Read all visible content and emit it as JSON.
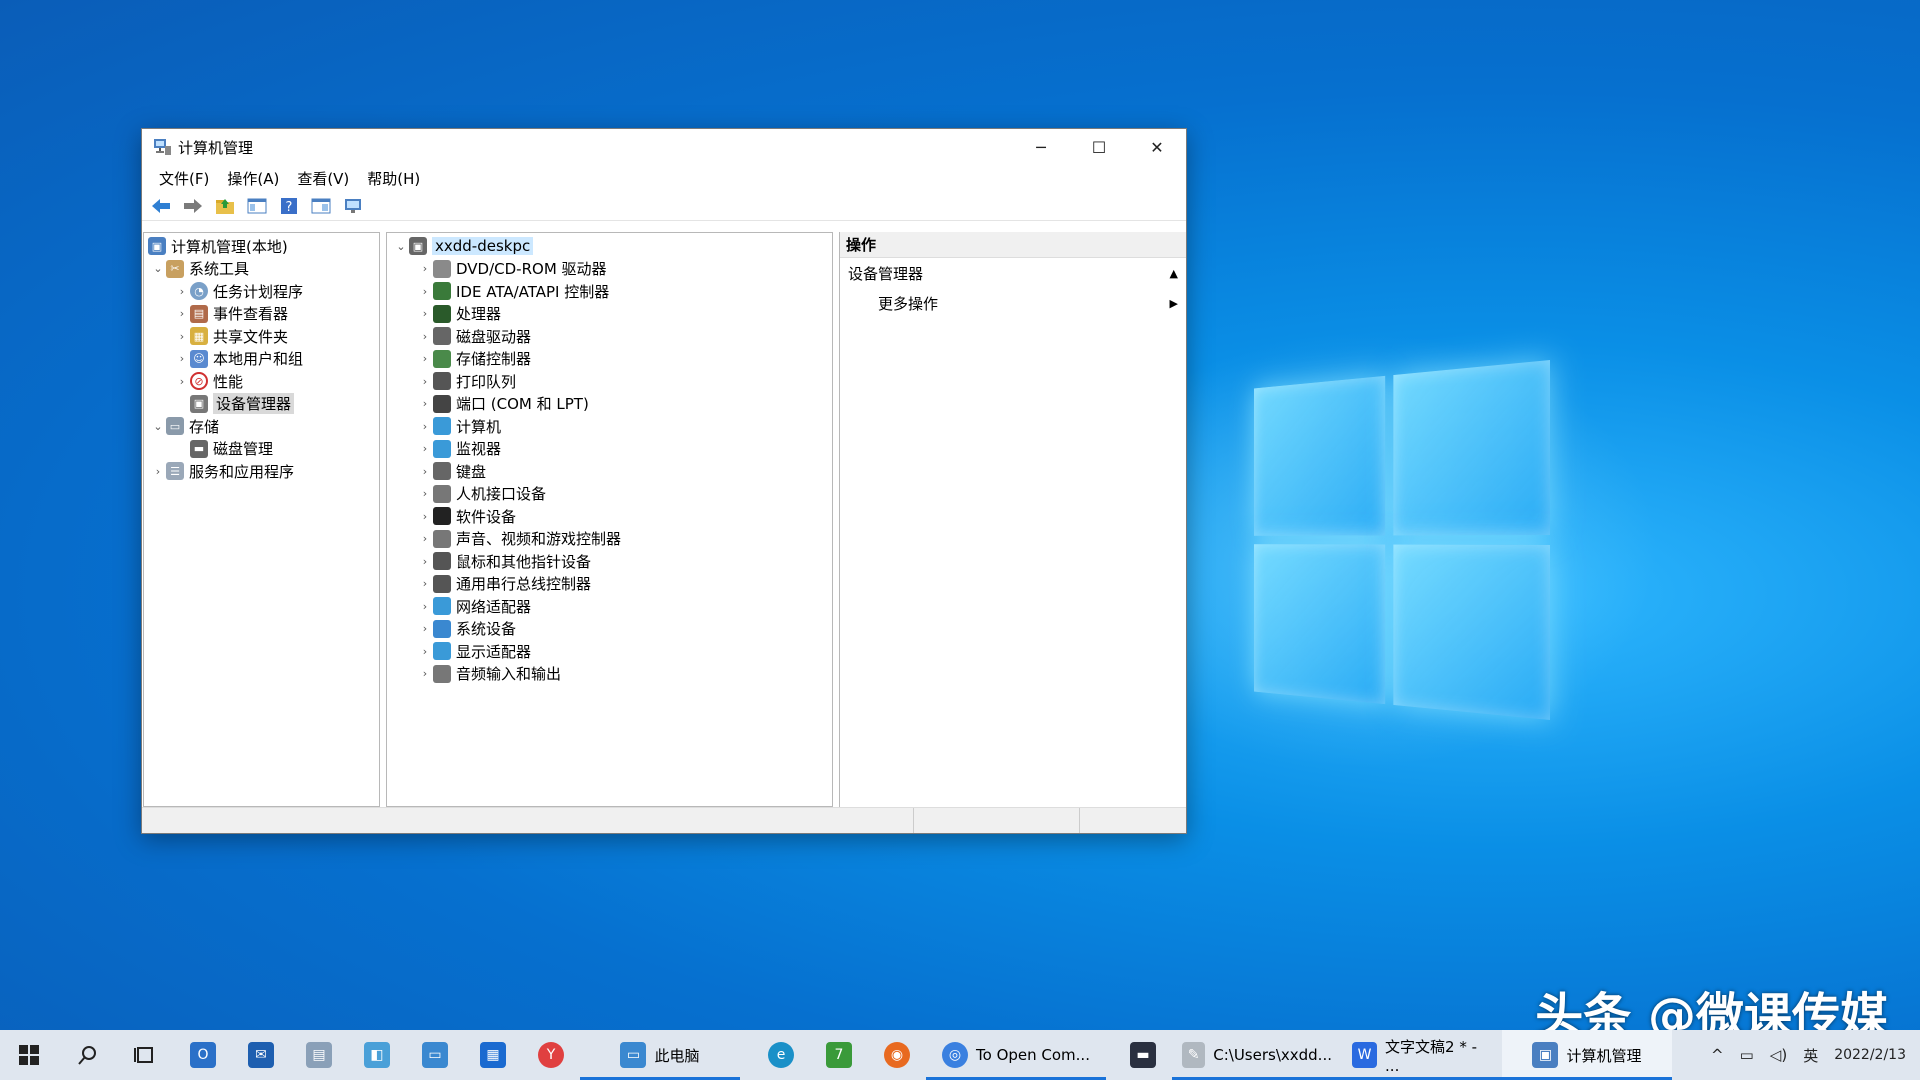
{
  "window": {
    "title": "计算机管理",
    "controls": {
      "minimize": "─",
      "maximize": "☐",
      "close": "✕"
    }
  },
  "menu": [
    "文件(F)",
    "操作(A)",
    "查看(V)",
    "帮助(H)"
  ],
  "toolbar_icons": [
    "back-icon",
    "forward-icon",
    "up-folder-icon",
    "show-hide-tree-icon",
    "help-icon",
    "properties-icon",
    "monitor-icon"
  ],
  "left_tree": {
    "root": "计算机管理(本地)",
    "system_tools": "系统工具",
    "task_scheduler": "任务计划程序",
    "event_viewer": "事件查看器",
    "shared_folders": "共享文件夹",
    "local_users": "本地用户和组",
    "performance": "性能",
    "device_manager": "设备管理器",
    "storage": "存储",
    "disk_management": "磁盘管理",
    "services": "服务和应用程序"
  },
  "device_tree": {
    "root": "xxdd-deskpc",
    "categories": [
      "DVD/CD-ROM 驱动器",
      "IDE ATA/ATAPI 控制器",
      "处理器",
      "磁盘驱动器",
      "存储控制器",
      "打印队列",
      "端口 (COM 和 LPT)",
      "计算机",
      "监视器",
      "键盘",
      "人机接口设备",
      "软件设备",
      "声音、视频和游戏控制器",
      "鼠标和其他指针设备",
      "通用串行总线控制器",
      "网络适配器",
      "系统设备",
      "显示适配器",
      "音频输入和输出"
    ]
  },
  "actions": {
    "header": "操作",
    "section": "设备管理器",
    "more": "更多操作"
  },
  "taskbar": {
    "this_pc": "此电脑",
    "chrome": "To Open Com...",
    "notepad": "C:\\Users\\xxdd...",
    "wps": "文字文稿2 * - ...",
    "computer_mgmt": "计算机管理",
    "ime": "英",
    "date": "2022/2/13"
  },
  "watermark": "头条 @微课传媒"
}
